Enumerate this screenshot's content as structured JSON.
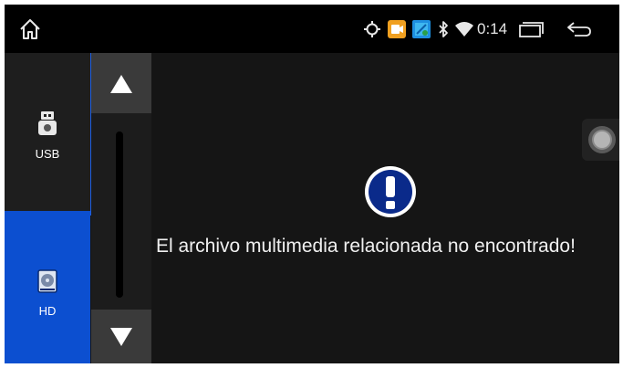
{
  "statusbar": {
    "time": "0:14",
    "icons": [
      "home-icon",
      "location-icon",
      "app-icon",
      "app-icon",
      "bluetooth-icon",
      "wifi-icon",
      "recents-icon",
      "back-icon"
    ]
  },
  "sidebar": {
    "items": [
      {
        "label": "USB",
        "icon": "usb-drive-icon",
        "active": false
      },
      {
        "label": "HD",
        "icon": "hard-disk-icon",
        "active": true
      }
    ]
  },
  "main": {
    "message": "El archivo multimedia relacionada no encontrado!",
    "alert_icon": "exclamation-icon"
  },
  "colors": {
    "active_source": "#0c4fd0",
    "alert_circle": "#0a2a8a",
    "background": "#151515"
  }
}
